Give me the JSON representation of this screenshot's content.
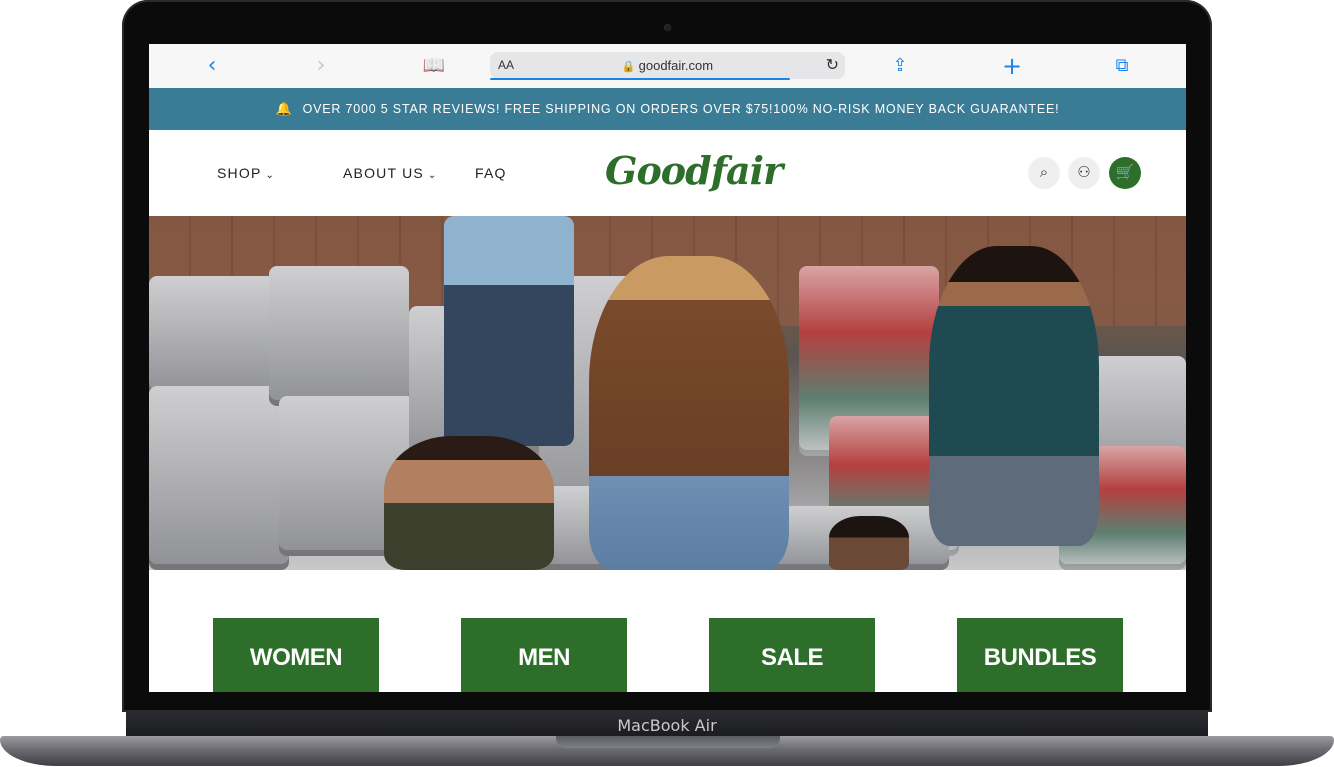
{
  "device": {
    "label": "MacBook Air"
  },
  "browser": {
    "back_icon": "chevron-left-icon",
    "forward_icon": "chevron-right-icon",
    "reader_label": "AA",
    "url": "goodfair.com",
    "back_glyph": "‹",
    "forward_glyph": "›",
    "book_glyph": "📖",
    "share_glyph": "⇪",
    "new_tab_glyph": "+",
    "tabs_glyph": "⧉",
    "reload_glyph": "↻",
    "lock_glyph": "🔒"
  },
  "announcement": {
    "text": "OVER 7000 5 STAR REVIEWS! FREE SHIPPING ON ORDERS OVER $75!100% NO-RISK MONEY BACK GUARANTEE!",
    "bell_glyph": "🔔"
  },
  "header": {
    "nav": [
      {
        "label": "SHOP",
        "has_dropdown": true
      },
      {
        "label": "ABOUT US",
        "has_dropdown": true
      },
      {
        "label": "FAQ",
        "has_dropdown": false
      }
    ],
    "caret_glyph": "⌄",
    "logo_text": "Goodfair",
    "search_glyph": "⌕",
    "account_glyph": "⚇",
    "cart_glyph": "🛒"
  },
  "categories": [
    {
      "label": "WOMEN"
    },
    {
      "label": "MEN"
    },
    {
      "label": "SALE"
    },
    {
      "label": "BUNDLES"
    }
  ],
  "colors": {
    "brand_green": "#2d6e2a",
    "announcement_bg": "#3a7b95",
    "browser_blue": "#1b84e8"
  }
}
